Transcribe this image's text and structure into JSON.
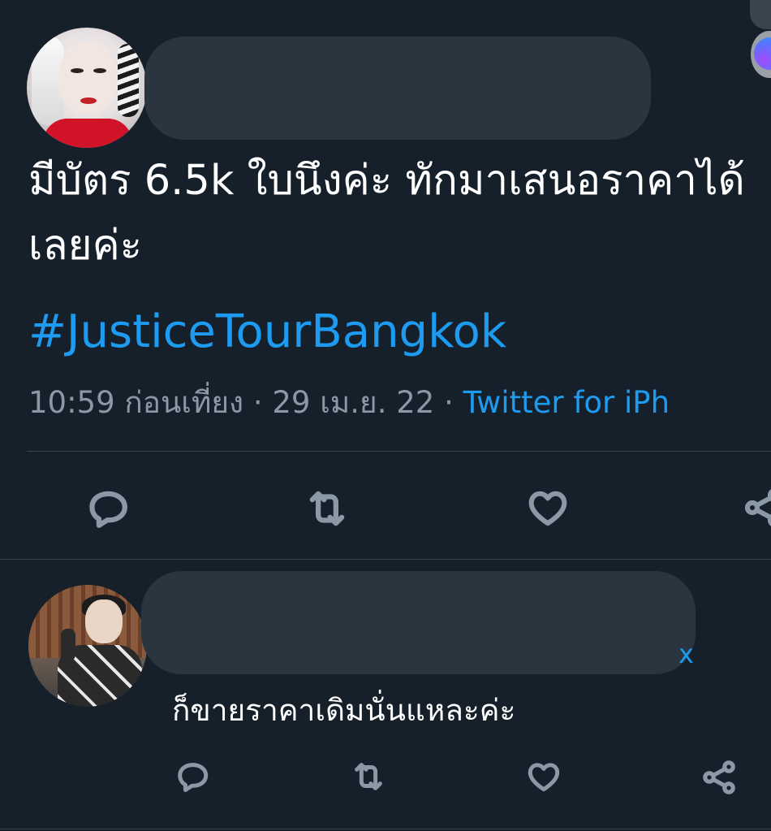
{
  "main_tweet": {
    "text": "มีบัตร 6.5k ใบนึงค่ะ ทักมาเสนอราคาได้เลยค่ะ",
    "hashtag": "#JusticeTourBangkok",
    "time": "10:59 ก่อนเที่ยง",
    "date": "29 เม.ย. 22",
    "separator": "·",
    "client": "Twitter for iPh"
  },
  "reply_tweet": {
    "handle_tail": "x",
    "text": "ก็ขายราคาเดิมนั่นแหละค่ะ"
  },
  "icons": {
    "reply": "reply-icon",
    "retweet": "retweet-icon",
    "like": "like-icon",
    "share": "share-icon"
  },
  "colors": {
    "background": "#15202b",
    "accent": "#1d9bf0",
    "muted": "#8b98a5",
    "text": "#ffffff",
    "divider": "#38444d"
  }
}
